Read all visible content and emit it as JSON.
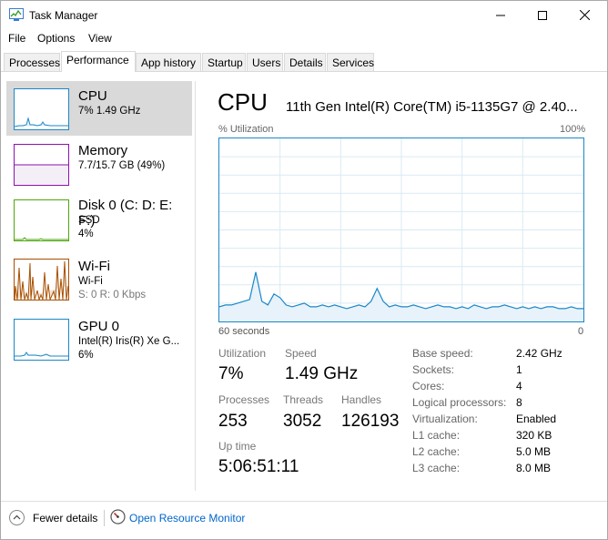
{
  "window": {
    "title": "Task Manager"
  },
  "menu": [
    "File",
    "Options",
    "View"
  ],
  "tabs": [
    "Processes",
    "Performance",
    "App history",
    "Startup",
    "Users",
    "Details",
    "Services"
  ],
  "sidebar": [
    {
      "name": "CPU",
      "line1": "7%  1.49 GHz",
      "line2": ""
    },
    {
      "name": "Memory",
      "line1": "7.7/15.7 GB (49%)",
      "line2": ""
    },
    {
      "name": "Disk 0 (C: D: E: F:)",
      "line1": "SSD",
      "line2": "4%"
    },
    {
      "name": "Wi-Fi",
      "line1": "Wi-Fi",
      "line2": "S: 0  R: 0 Kbps"
    },
    {
      "name": "GPU 0",
      "line1": "Intel(R) Iris(R) Xe G...",
      "line2": "6%"
    }
  ],
  "main": {
    "title": "CPU",
    "model": "11th Gen Intel(R) Core(TM) i5-1135G7 @ 2.40...",
    "util_label": "% Utilization",
    "util_max": "100%",
    "axis_left": "60 seconds",
    "axis_right": "0"
  },
  "chart_data": {
    "type": "line",
    "title": "",
    "ylabel": "% Utilization",
    "ylim": [
      0,
      100
    ],
    "x_range_seconds": [
      60,
      0
    ],
    "series": [
      {
        "values": [
          8,
          9,
          9,
          10,
          11,
          12,
          27,
          11,
          9,
          15,
          13,
          9,
          8,
          9,
          10,
          8,
          8,
          9,
          8,
          9,
          8,
          7,
          8,
          9,
          8,
          11,
          18,
          11,
          8,
          9,
          8,
          8,
          9,
          8,
          7,
          8,
          9,
          8,
          8,
          7,
          8,
          7,
          9,
          8,
          7,
          8,
          8,
          9,
          8,
          7,
          8,
          7,
          8,
          7,
          8,
          8,
          7,
          7,
          8,
          7,
          7
        ]
      }
    ],
    "grid": true,
    "line_color": "#1b87c7"
  },
  "stats": {
    "utilization_label": "Utilization",
    "utilization": "7%",
    "speed_label": "Speed",
    "speed": "1.49 GHz",
    "processes_label": "Processes",
    "processes": "253",
    "threads_label": "Threads",
    "threads": "3052",
    "handles_label": "Handles",
    "handles": "126193",
    "uptime_label": "Up time",
    "uptime": "5:06:51:11"
  },
  "details": [
    {
      "label": "Base speed:",
      "value": "2.42 GHz"
    },
    {
      "label": "Sockets:",
      "value": "1"
    },
    {
      "label": "Cores:",
      "value": "4"
    },
    {
      "label": "Logical processors:",
      "value": "8"
    },
    {
      "label": "Virtualization:",
      "value": "Enabled"
    },
    {
      "label": "L1 cache:",
      "value": "320 KB"
    },
    {
      "label": "L2 cache:",
      "value": "5.0 MB"
    },
    {
      "label": "L3 cache:",
      "value": "8.0 MB"
    }
  ],
  "footer": {
    "fewer_details": "Fewer details",
    "open_rm": "Open Resource Monitor"
  }
}
